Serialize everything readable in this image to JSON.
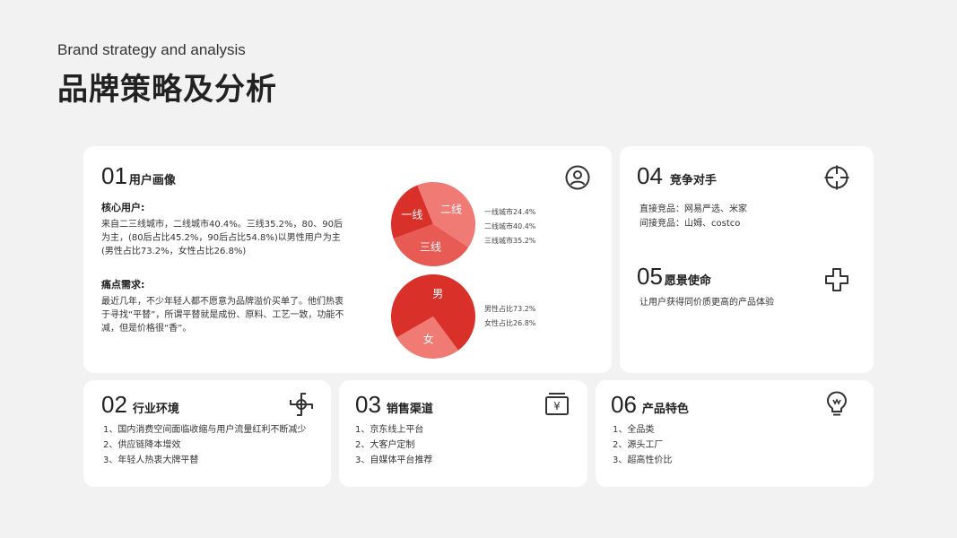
{
  "header": {
    "subtitle": "Brand strategy and analysis",
    "title": "品牌策略及分析"
  },
  "card01": {
    "num": "01",
    "label": "用户画像",
    "icon": "user-circle-icon",
    "core_heading": "核心用户:",
    "core_text": "来自二三线城市，二线城市40.4%。三线35.2%，80、90后为主，(80后占比45.2%，90后占比54.8%)以男性用户为主(男性占比73.2%，女性占比26.8%)",
    "pain_heading": "痛点需求:",
    "pain_text": "最近几年，不少年轻人都不愿意为品牌溢价买单了。他们热衷于寻找“平替”，所谓平替就是成份、原料、工艺一致，功能不减，但是价格很“香”。",
    "city_legend": [
      "一线城市24.4%",
      "二线城市40.4%",
      "三线城市35.2%"
    ],
    "gender_legend": [
      "男性占比73.2%",
      "女性占比26.8%"
    ]
  },
  "chart_data": [
    {
      "type": "pie",
      "categories": [
        "一线",
        "二线",
        "三线"
      ],
      "values": [
        24.4,
        40.4,
        35.2
      ],
      "colors": [
        "#d9302a",
        "#ef7b74",
        "#e85a54"
      ]
    },
    {
      "type": "pie",
      "categories": [
        "男",
        "女"
      ],
      "values": [
        73.2,
        26.8
      ],
      "colors": [
        "#d9302a",
        "#ef7b74"
      ]
    }
  ],
  "card04": {
    "num": "04",
    "label": "竞争对手",
    "icon": "crosshair-icon",
    "lines": [
      "直接竞品：网易严选、米家",
      "间接竞品：山姆、costco"
    ]
  },
  "card05": {
    "num": "05",
    "label": "愿景使命",
    "icon": "puzzle-cross-icon",
    "text": "让用户获得同价质更高的产品体验"
  },
  "card02": {
    "num": "02",
    "label": "行业环境",
    "icon": "pinwheel-icon",
    "items": [
      "1、国内消费空间面临收缩与用户流量红利不断减少",
      "2、供应链降本增效",
      "3、年轻人热衷大牌平替"
    ]
  },
  "card03": {
    "num": "03",
    "label": "销售渠道",
    "icon": "yen-register-icon",
    "items": [
      "1、京东线上平台",
      "2、大客户定制",
      "3、自媒体平台推荐"
    ]
  },
  "card06": {
    "num": "06",
    "label": "产品特色",
    "icon": "lightbulb-icon",
    "items": [
      "1、全品类",
      "2、源头工厂",
      "3、超高性价比"
    ]
  }
}
